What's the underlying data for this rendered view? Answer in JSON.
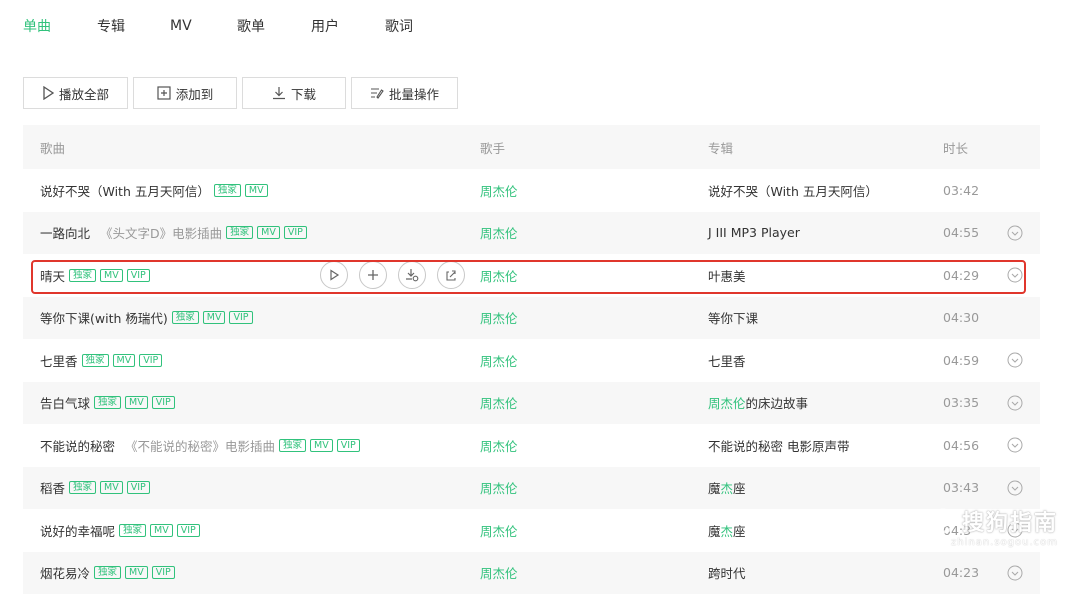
{
  "tabs": [
    "单曲",
    "专辑",
    "MV",
    "歌单",
    "用户",
    "歌词"
  ],
  "toolbar": {
    "play_all": "播放全部",
    "add_to": "添加到",
    "download": "下载",
    "batch": "批量操作"
  },
  "columns": {
    "song": "歌曲",
    "singer": "歌手",
    "album": "专辑",
    "duration": "时长"
  },
  "colors": {
    "accent": "#31c27c",
    "highlight_border": "#e0362c"
  },
  "rows": [
    {
      "title": "说好不哭（With 五月天阿信）",
      "subtitle": "",
      "tags": [
        "独家",
        "MV"
      ],
      "singer": "周杰伦",
      "album": "说好不哭（With 五月天阿信）",
      "duration": "03:42",
      "more": false
    },
    {
      "title": "一路向北",
      "subtitle": "《头文字D》电影插曲",
      "tags": [
        "独家",
        "MV",
        "VIP"
      ],
      "singer": "周杰伦",
      "album": "J III MP3 Player",
      "duration": "04:55",
      "more": true
    },
    {
      "title": "晴天",
      "subtitle": "",
      "tags": [
        "独家",
        "MV",
        "VIP"
      ],
      "singer": "周杰伦",
      "album": "叶惠美",
      "duration": "04:29",
      "more": true,
      "hover": true
    },
    {
      "title": "等你下课(with 杨瑞代)",
      "subtitle": "",
      "tags": [
        "独家",
        "MV",
        "VIP"
      ],
      "singer": "周杰伦",
      "album": "等你下课",
      "duration": "04:30",
      "more": false
    },
    {
      "title": "七里香",
      "subtitle": "",
      "tags": [
        "独家",
        "MV",
        "VIP"
      ],
      "singer": "周杰伦",
      "album": "七里香",
      "duration": "04:59",
      "more": true
    },
    {
      "title": "告白气球",
      "subtitle": "",
      "tags": [
        "独家",
        "MV",
        "VIP"
      ],
      "singer": "周杰伦",
      "album_hl": "周杰伦",
      "album": "的床边故事",
      "duration": "03:35",
      "more": true
    },
    {
      "title": "不能说的秘密",
      "subtitle": "《不能说的秘密》电影插曲",
      "tags": [
        "独家",
        "MV",
        "VIP"
      ],
      "singer": "周杰伦",
      "album": "不能说的秘密 电影原声带",
      "duration": "04:56",
      "more": true
    },
    {
      "title": "稻香",
      "subtitle": "",
      "tags": [
        "独家",
        "MV",
        "VIP"
      ],
      "singer": "周杰伦",
      "album_pre": "魔",
      "album_hl": "杰",
      "album": "座",
      "duration": "03:43",
      "more": true
    },
    {
      "title": "说好的幸福呢",
      "subtitle": "",
      "tags": [
        "独家",
        "MV",
        "VIP"
      ],
      "singer": "周杰伦",
      "album_pre": "魔",
      "album_hl": "杰",
      "album": "座",
      "duration": "04:3",
      "more": true
    },
    {
      "title": "烟花易冷",
      "subtitle": "",
      "tags": [
        "独家",
        "MV",
        "VIP"
      ],
      "singer": "周杰伦",
      "album": "跨时代",
      "duration": "04:23",
      "more": true
    }
  ],
  "watermark": {
    "title": "搜狗指南",
    "url": "zhinan.sogou.com"
  }
}
